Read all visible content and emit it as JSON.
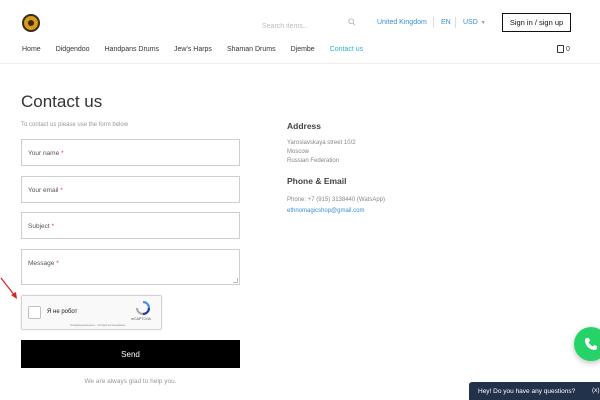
{
  "header": {
    "search_placeholder": "Search items...",
    "country": "United Kingdom",
    "language": "EN",
    "currency": "USD",
    "sign_in_label": "Sign in / sign up",
    "cart_count": "0"
  },
  "nav": {
    "items": [
      {
        "label": "Home"
      },
      {
        "label": "Didgendoo"
      },
      {
        "label": "Handpans Drums"
      },
      {
        "label": "Jew's Harps"
      },
      {
        "label": "Shaman Drums"
      },
      {
        "label": "Djembe"
      },
      {
        "label": "Contact us",
        "active": true
      }
    ]
  },
  "form": {
    "title": "Contact us",
    "subtitle": "To contact us please use the form below",
    "name_label": "Your name",
    "email_label": "Your email",
    "subject_label": "Subject",
    "message_label": "Message",
    "required_mark": "*",
    "captcha_label": "Я не робот",
    "captcha_brand": "reCAPTCHA",
    "captcha_links": "Конфиденциальность - Условия использования",
    "send_label": "Send",
    "footer_text": "We are always glad to help you."
  },
  "contact": {
    "address_heading": "Address",
    "address_lines": [
      "Yaroslavskaya street 10/2",
      "Moscow",
      "Russian Federation"
    ],
    "phone_heading": "Phone & Email",
    "phone": "Phone: +7 (915) 3138440 (WatsApp)",
    "email": "ethnomagicshop@gmail.com"
  },
  "chat": {
    "prompt": "Hey! Do you have any questions?",
    "close_label": "(x)"
  },
  "colors": {
    "accent": "#2ab3c9",
    "link": "#3b8ed6",
    "whatsapp": "#25d366",
    "chat_bg": "#22324a"
  }
}
